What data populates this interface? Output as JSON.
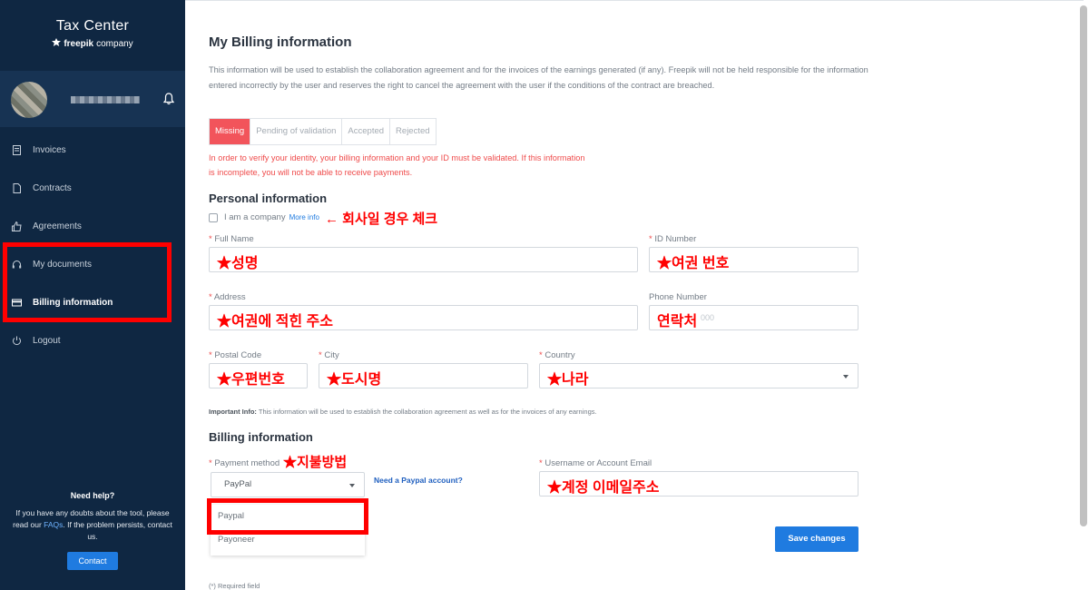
{
  "sidebar": {
    "brand_title": "Tax Center",
    "brand_sub_bold": "freepik",
    "brand_sub_light": "company",
    "items": [
      {
        "label": "Invoices",
        "icon": "invoice-icon"
      },
      {
        "label": "Contracts",
        "icon": "document-icon"
      },
      {
        "label": "Agreements",
        "icon": "thumbs-up-icon"
      },
      {
        "label": "My documents",
        "icon": "headset-icon"
      },
      {
        "label": "Billing information",
        "icon": "card-icon"
      },
      {
        "label": "Logout",
        "icon": "power-icon"
      }
    ],
    "help_title": "Need help?",
    "help_text_1": "If you have any doubts about the tool, please read our ",
    "help_link": "FAQs",
    "help_text_2": ". If the problem persists, contact us.",
    "contact_label": "Contact"
  },
  "main": {
    "title": "My Billing information",
    "intro": "This information will be used to establish the collaboration agreement and for the invoices of the earnings generated (if any). Freepik will not be held responsible for the information entered incorrectly by the user and reserves the right to cancel the agreement with the user if the conditions of the contract are breached.",
    "tabs": [
      "Missing",
      "Pending of validation",
      "Accepted",
      "Rejected"
    ],
    "warning": "In order to verify your identity, your billing information and your ID must be validated. If this information is incomplete, you will not be able to receive payments.",
    "personal_title": "Personal information",
    "company_label": "I am a company",
    "more_info": "More info",
    "company_annotation": "← 회사일 경우 체크",
    "fields": {
      "full_name": {
        "label": "Full Name",
        "annotation": "★성명"
      },
      "id_number": {
        "label": "ID Number",
        "annotation": "★여권 번호"
      },
      "address": {
        "label": "Address",
        "annotation": "★여권에 적힌 주소"
      },
      "phone": {
        "label": "Phone Number",
        "annotation": "연락처",
        "placeholder_tail": "000"
      },
      "postal": {
        "label": "Postal Code",
        "annotation": "★우편번호"
      },
      "city": {
        "label": "City",
        "annotation": "★도시명"
      },
      "country": {
        "label": "Country",
        "annotation": "★나라"
      }
    },
    "important_bold": "Important Info:",
    "important_text": " This information will be used to establish the collaboration agreement as well as for the invoices of any earnings.",
    "billing_title": "Billing information",
    "payment_label": "Payment method",
    "payment_annotation": "★지불방법",
    "payment_value": "PayPal",
    "paypal_link": "Need a Paypal account?",
    "dropdown_options": [
      "Paypal",
      "Payoneer"
    ],
    "account_label": "Username or Account Email",
    "account_annotation": "★계정 이메일주소",
    "save_label": "Save changes",
    "required_note": "(*) Required field"
  },
  "colors": {
    "sidebar_bg": "#0f2742",
    "accent": "#1f7be0",
    "missing_tab": "#f2545b",
    "annotation": "#ff0000"
  }
}
